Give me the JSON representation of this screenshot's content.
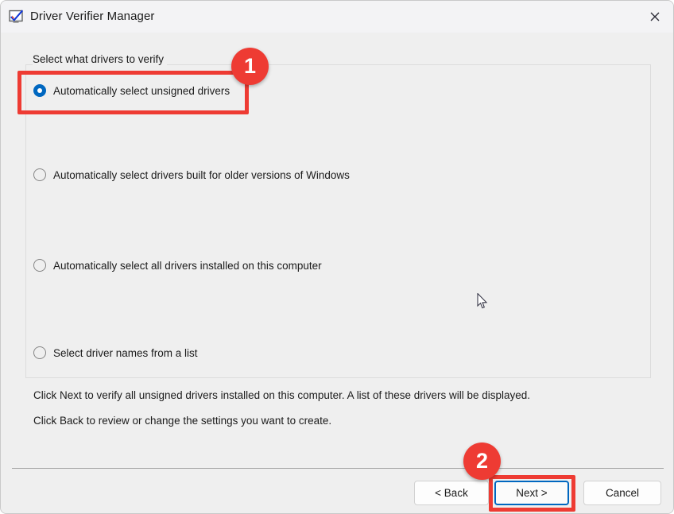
{
  "window": {
    "title": "Driver Verifier Manager",
    "icon": "driver-verifier-icon",
    "close_icon": "close-icon",
    "accent_color": "#0067c0",
    "annotation_color": "#ee3b33",
    "background_color": "#efefef",
    "titlebar_color": "#f3f3f5"
  },
  "group": {
    "label": "Select what drivers to verify"
  },
  "options": [
    {
      "label": "Automatically select unsigned drivers",
      "selected": true
    },
    {
      "label": "Automatically select drivers built for older versions of Windows",
      "selected": false
    },
    {
      "label": "Automatically select all drivers installed on this computer",
      "selected": false
    },
    {
      "label": "Select driver names from a list",
      "selected": false
    }
  ],
  "instructions": [
    "Click Next to verify all unsigned drivers installed on this computer. A list of these drivers will be displayed.",
    "Click Back to review or change the settings you want to create."
  ],
  "buttons": {
    "back": "< Back",
    "next": "Next >",
    "cancel": "Cancel"
  },
  "annotations": {
    "badge_1": "1",
    "badge_2": "2"
  }
}
